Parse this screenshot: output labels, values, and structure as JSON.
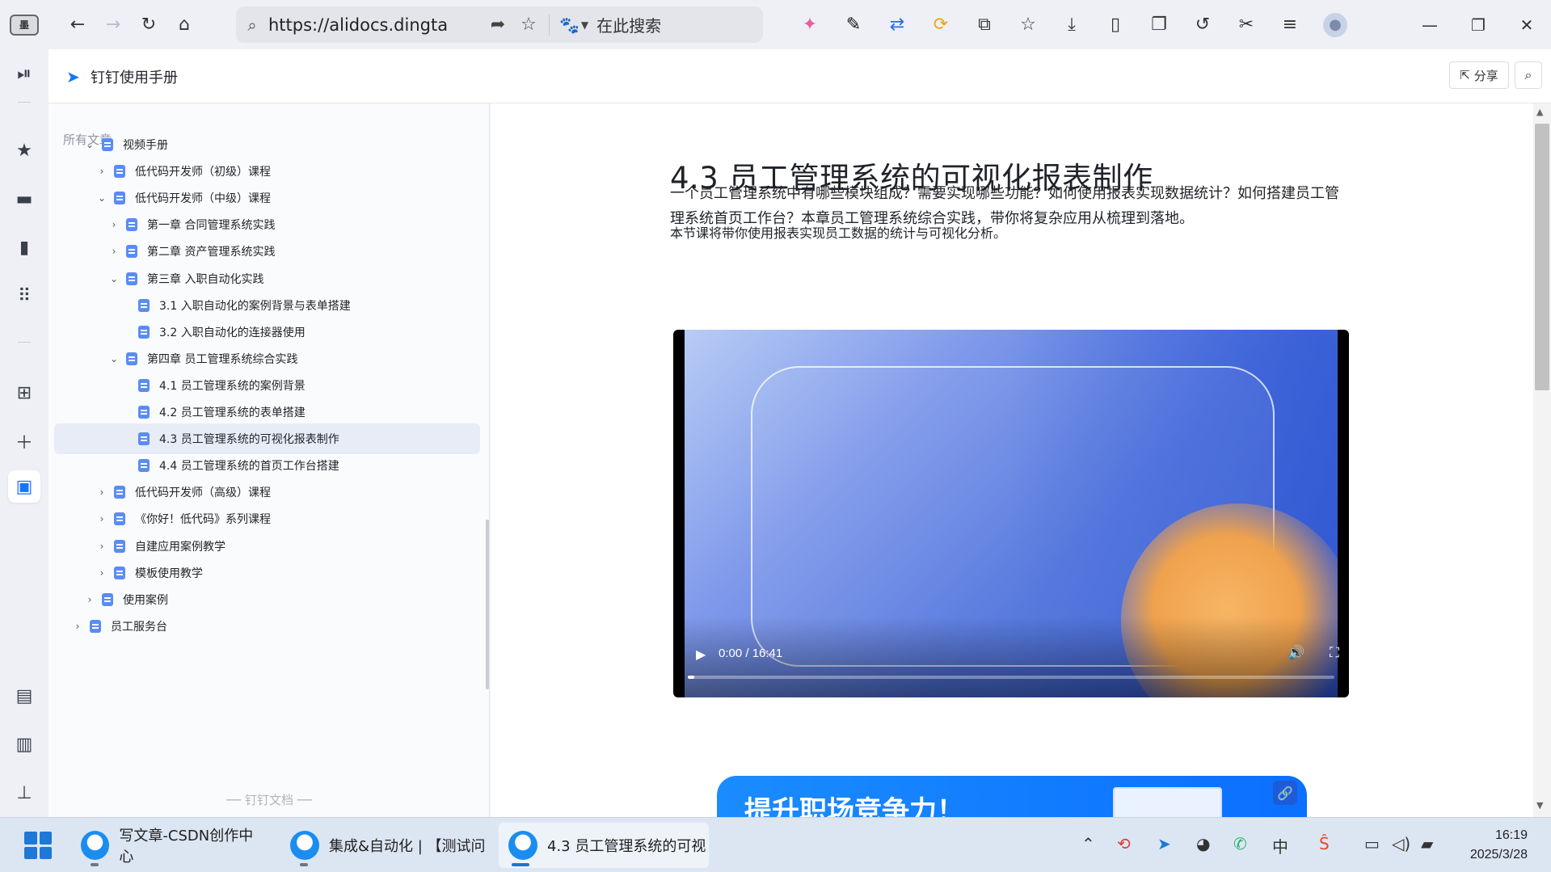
{
  "browser": {
    "url": "https://alidocs.dingta",
    "search_engine_label": "在此搜索",
    "app_logo_text": "墨"
  },
  "doc_header": {
    "title": "钉钉使用手册",
    "share_label": "分享"
  },
  "rail": {
    "items": [
      "play-panel-icon",
      "star-icon",
      "folder-icon",
      "phone-icon",
      "grid-apps-icon",
      "widget-add-icon",
      "plus-icon",
      "dingdoc-icon",
      "bookmark-folder-icon",
      "briefcase-icon",
      "pin-icon"
    ]
  },
  "sidebar": {
    "heading": "所有文章",
    "footer": "钉钉文档",
    "items": [
      {
        "label": "视频手册",
        "level": 1,
        "state": "expanded"
      },
      {
        "label": "低代码开发师（初级）课程",
        "level": 2,
        "state": "collapsed"
      },
      {
        "label": "低代码开发师（中级）课程",
        "level": 2,
        "state": "expanded"
      },
      {
        "label": "第一章 合同管理系统实践",
        "level": 3,
        "state": "collapsed"
      },
      {
        "label": "第二章 资产管理系统实践",
        "level": 3,
        "state": "collapsed"
      },
      {
        "label": "第三章 入职自动化实践",
        "level": 3,
        "state": "expanded"
      },
      {
        "label": "3.1 入职自动化的案例背景与表单搭建",
        "level": 4,
        "state": "leaf"
      },
      {
        "label": "3.2 入职自动化的连接器使用",
        "level": 4,
        "state": "leaf"
      },
      {
        "label": "第四章 员工管理系统综合实践",
        "level": 3,
        "state": "expanded"
      },
      {
        "label": "4.1 员工管理系统的案例背景",
        "level": 4,
        "state": "leaf"
      },
      {
        "label": "4.2 员工管理系统的表单搭建",
        "level": 4,
        "state": "leaf"
      },
      {
        "label": "4.3 员工管理系统的可视化报表制作",
        "level": 4,
        "state": "leaf",
        "selected": true
      },
      {
        "label": "4.4 员工管理系统的首页工作台搭建",
        "level": 4,
        "state": "leaf"
      },
      {
        "label": "低代码开发师（高级）课程",
        "level": 2,
        "state": "collapsed"
      },
      {
        "label": "《你好！低代码》系列课程",
        "level": 2,
        "state": "collapsed"
      },
      {
        "label": "自建应用案例教学",
        "level": 2,
        "state": "collapsed"
      },
      {
        "label": "模板使用教学",
        "level": 2,
        "state": "collapsed"
      },
      {
        "label": "使用案例",
        "level": 1,
        "state": "collapsed"
      },
      {
        "label": "员工服务台",
        "level": 0,
        "state": "collapsed"
      }
    ]
  },
  "article": {
    "title": "4.3 员工管理系统的可视化报表制作",
    "para1_line1": "一个员工管理系统中有哪些模块组成？需要实现哪些功能？如何使用报表实现数据统计？如何搭建员工管",
    "para1_line2": "理系统首页工作台？本章员工管理系统综合实践，带你将复杂应用从梳理到落地。",
    "para2": "本节课将带你使用报表实现员工数据的统计与可视化分析。",
    "video": {
      "time_display": "0:00 / 16:41",
      "progress_fraction": 0.0
    },
    "banner_text": "提升职场竞争力！"
  },
  "taskbar": {
    "tasks": [
      {
        "label": "写文章-CSDN创作中心",
        "active": false
      },
      {
        "label": "集成&自动化 | 【测试问",
        "active": false
      },
      {
        "label": "4.3 员工管理系统的可视",
        "active": true
      }
    ],
    "ime_label": "中",
    "time": "16:19",
    "date": "2025/3/28"
  }
}
